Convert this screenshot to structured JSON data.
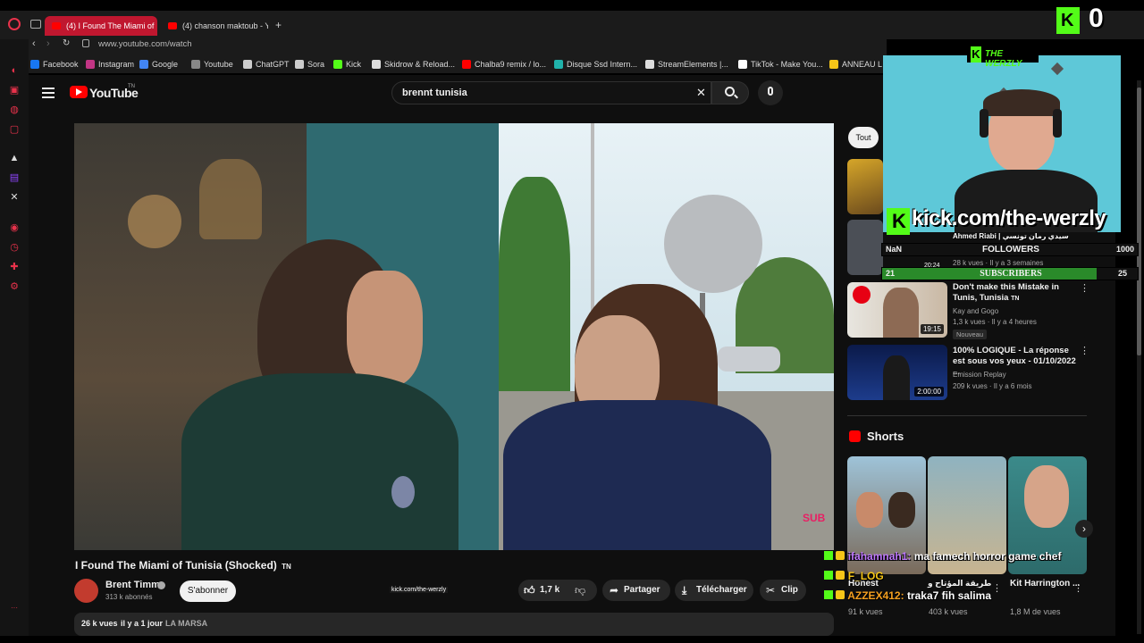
{
  "browser": {
    "tabs": [
      {
        "label": "(4) I Found The Miami of",
        "active": true
      },
      {
        "label": "(4) chanson maktoub - Yo",
        "active": false
      }
    ],
    "new_tab": "+",
    "url": "www.youtube.com/watch",
    "bookmarks": [
      {
        "label": "Facebook",
        "color": "#1877f2"
      },
      {
        "label": "Instagram",
        "color": "#c13584"
      },
      {
        "label": "Google",
        "color": "#4285f4"
      },
      {
        "label": "Youtube",
        "color": "#888888"
      },
      {
        "label": "ChatGPT",
        "color": "#cccccc"
      },
      {
        "label": "Sora",
        "color": "#cccccc"
      },
      {
        "label": "Kick",
        "color": "#53fc18"
      },
      {
        "label": "Skidrow & Reload...",
        "color": "#dddddd"
      },
      {
        "label": "Chalba9 remix / lo...",
        "color": "#ff0000"
      },
      {
        "label": "Disque Ssd Intern...",
        "color": "#20b2aa"
      },
      {
        "label": "StreamElements |...",
        "color": "#dddddd"
      },
      {
        "label": "TikTok - Make You...",
        "color": "#ffffff"
      },
      {
        "label": "ANNEAU L",
        "color": "#f5c518"
      }
    ]
  },
  "youtube": {
    "logo": "YouTube",
    "region": "TN",
    "search": {
      "value": "brennt tunisia",
      "clear": "✕"
    },
    "video": {
      "title": "I Found The Miami of Tunisia (Shocked)",
      "title_flag": "TN",
      "channel": "Brent Timm",
      "subscribers": "313 k abonnés",
      "subscribe_label": "S'abonner",
      "likes": "1,7 k",
      "share": "Partager",
      "download": "Télécharger",
      "clip": "Clip",
      "views": "26 k vues",
      "age": "il y a 1 jour",
      "location": "LA MARSA",
      "watermark": "SUB"
    },
    "filter_chip": "Tout",
    "recommendations": [
      {
        "title": "Don't make this Mistake in Tunis, Tunisia",
        "flag": "TN",
        "channel": "Kay and Gogo",
        "meta": "1,3 k vues · Il y a 4 heures",
        "badge": "Nouveau",
        "duration": "19:15"
      },
      {
        "title": "100% LOGIQUE - La réponse est sous vos yeux - 01/10/2022 ...",
        "flag": "",
        "channel": "Emission Replay",
        "meta": "209 k vues · Il y a 6 mois",
        "badge": "",
        "duration": "2:00:00"
      }
    ],
    "partial_rec": {
      "channel": "Ahmed Riabi | سيدي رمان تونسي",
      "meta": "28 k vues · Il y a 3 semaines",
      "duration": "20:24"
    },
    "shorts": {
      "heading": "Shorts",
      "items": [
        {
          "title": "Honest",
          "views": "91 k vues"
        },
        {
          "title": "طريقة المؤتاح و",
          "views": "403 k vues"
        },
        {
          "title": "Kit Harrington ...",
          "views": "1,8 M de vues"
        }
      ]
    }
  },
  "overlay": {
    "counter": "0",
    "brand": "THE WERZLY",
    "kick_url": "kick.com/the-werzly",
    "followers": {
      "current": "NaN",
      "label": "FOLLOWERS",
      "goal": "1000",
      "progress": 0.0
    },
    "subscribers": {
      "current": "21",
      "label": "SUBSCRIBERS",
      "goal": "25",
      "progress": 0.84
    },
    "center_tag": "kick.com/the-werzly",
    "chat": [
      {
        "user": "ifahamnah1:",
        "msg": "ma famech horror game chef"
      },
      {
        "user": "F_LOG",
        "msg": ""
      },
      {
        "user": "AZZEX412:",
        "msg": "traka7 fih salima"
      }
    ],
    "colors": {
      "kick": "#53fc18",
      "followers_bar": "#1f6d1f",
      "subs_bar": "#2a8a2a"
    }
  }
}
